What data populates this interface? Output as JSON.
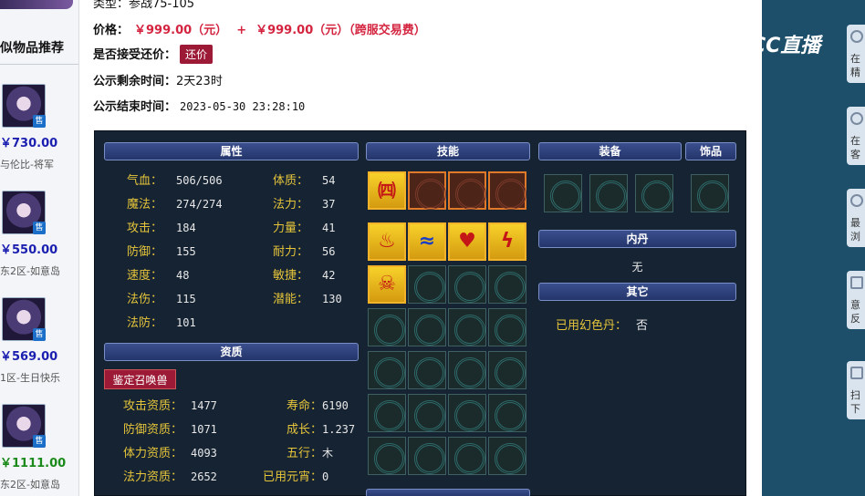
{
  "sidebar": {
    "title": "似物品推荐",
    "items": [
      {
        "price": "￥730.00",
        "desc": "与伦比-将军",
        "badge": "售",
        "price_color": "blue"
      },
      {
        "price": "￥550.00",
        "desc": "东2区-如意岛",
        "badge": "售",
        "price_color": "blue"
      },
      {
        "price": "￥569.00",
        "desc": "1区-生日快乐",
        "badge": "售",
        "price_color": "blue"
      },
      {
        "price": "￥1111.00",
        "desc": "东2区-如意岛",
        "badge": "售",
        "price_color": "green"
      }
    ]
  },
  "info": {
    "type_line": "类型：参战75-105",
    "price_label": "价格：",
    "price_value": "￥999.00（元）",
    "plus": "+",
    "price_value2": "￥999.00（元）（跨服交易费）",
    "haggle_label": "是否接受还价：",
    "haggle_button": "还价",
    "remain_label": "公示剩余时间：",
    "remain_value": "2天23时",
    "end_label": "公示结束时间：",
    "end_value": "2023-05-30 23:28:10"
  },
  "panel": {
    "attr_header": "属性",
    "skill_header": "技能",
    "equip_header": "装备",
    "ornament_header": "饰品",
    "neidan_header": "内丹",
    "neidan_value": "无",
    "other_header": "其它",
    "other_label": "已用幻色丹：",
    "other_value": "否",
    "qualif_header": "资质",
    "identify_button": "鉴定召唤兽",
    "attrs_left": [
      {
        "k": "气血：",
        "v": "506/506"
      },
      {
        "k": "魔法：",
        "v": "274/274"
      },
      {
        "k": "攻击：",
        "v": "184"
      },
      {
        "k": "防御：",
        "v": "155"
      },
      {
        "k": "速度：",
        "v": "48"
      },
      {
        "k": "法伤：",
        "v": "115"
      },
      {
        "k": "法防：",
        "v": "101"
      }
    ],
    "attrs_right": [
      {
        "k": "体质：",
        "v": "54"
      },
      {
        "k": "法力：",
        "v": "37"
      },
      {
        "k": "力量：",
        "v": "41"
      },
      {
        "k": "耐力：",
        "v": "56"
      },
      {
        "k": "敏捷：",
        "v": "42"
      },
      {
        "k": "潜能：",
        "v": "130"
      }
    ],
    "qual_left": [
      {
        "k": "攻击资质：",
        "v": "1477"
      },
      {
        "k": "防御资质：",
        "v": "1071"
      },
      {
        "k": "体力资质：",
        "v": "4093"
      },
      {
        "k": "法力资质：",
        "v": "2652"
      }
    ],
    "qual_right": [
      {
        "k": "寿命：",
        "v": "6190"
      },
      {
        "k": "成长：",
        "v": "1.237"
      },
      {
        "k": "五行：",
        "v": "木"
      },
      {
        "k": "已用元宵：",
        "v": "0"
      }
    ],
    "skill_icons": [
      "fire-skill-icon",
      "water-skill-icon",
      "heart-skill-icon",
      "thunder-skill-icon",
      "skeleton-skill-icon"
    ]
  },
  "overlay": {
    "logo_text": "CC直播"
  },
  "right_strip": [
    {
      "text": "在精",
      "icon": "avatar-icon"
    },
    {
      "text": "在客",
      "icon": "cloud-icon"
    },
    {
      "text": "最浏",
      "icon": "clock-icon"
    },
    {
      "text": "意反",
      "icon": "edit-icon"
    },
    {
      "text": "扫下",
      "icon": "phone-icon"
    }
  ],
  "colors": {
    "price_red": "#d4243f",
    "button_red": "#9c1a36",
    "panel_bg": "#152333",
    "label_gold": "#e6c53a"
  }
}
